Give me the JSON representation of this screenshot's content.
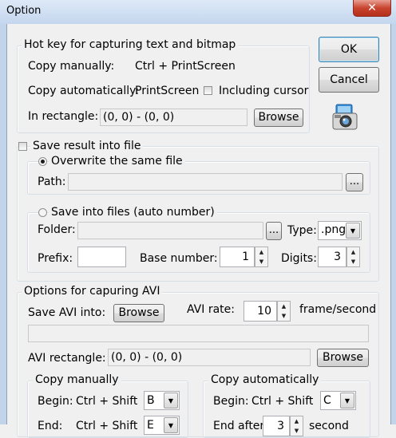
{
  "window": {
    "title": "Option",
    "close_glyph": "✕"
  },
  "buttons": {
    "ok": "OK",
    "cancel": "Cancel"
  },
  "hotkey_group": {
    "title": "Hot key for capturing text and bitmap",
    "copy_manually_label": "Copy manually:",
    "copy_manually_value": "Ctrl + PrintScreen",
    "copy_auto_label": "Copy automatically:",
    "copy_auto_value": "PrintScreen",
    "including_cursor_label": "Including cursor",
    "including_cursor_checked": false,
    "rect_label": "In rectangle:",
    "rect_value": "(0, 0) - (0, 0)",
    "browse_label": "Browse"
  },
  "save_file": {
    "label": "Save result into file",
    "checked": false,
    "overwrite_label": "Overwrite the same file",
    "overwrite_selected": true,
    "path_label": "Path:",
    "path_value": "",
    "path_browse": "...",
    "auto_number_label": "Save into files (auto number)",
    "auto_number_selected": false,
    "folder_label": "Folder:",
    "folder_value": "",
    "folder_browse": "...",
    "type_label": "Type:",
    "type_value": ".png",
    "prefix_label": "Prefix:",
    "prefix_value": "",
    "base_number_label": "Base number:",
    "base_number_value": "1",
    "digits_label": "Digits:",
    "digits_value": "3"
  },
  "avi": {
    "title": "Options for capuring AVI",
    "save_into_label": "Save AVI into:",
    "browse_label": "Browse",
    "rate_label": "AVI rate:",
    "rate_value": "10",
    "rate_unit": "frame/second",
    "path_value": "",
    "rect_label": "AVI rectangle:",
    "rect_value": "(0, 0) - (0, 0)",
    "rect_browse": "Browse",
    "copy_manually": {
      "title": "Copy manually",
      "begin_label": "Begin:",
      "begin_keys": "Ctrl + Shift",
      "begin_key": "B",
      "end_label": "End:",
      "end_keys": "Ctrl + Shift",
      "end_key": "E"
    },
    "copy_auto": {
      "title": "Copy automatically",
      "begin_label": "Begin:",
      "begin_keys": "Ctrl + Shift",
      "begin_key": "C",
      "end_label": "End after",
      "end_value": "3",
      "end_unit": "second"
    }
  },
  "icons": {
    "camera": "camera-icon"
  }
}
